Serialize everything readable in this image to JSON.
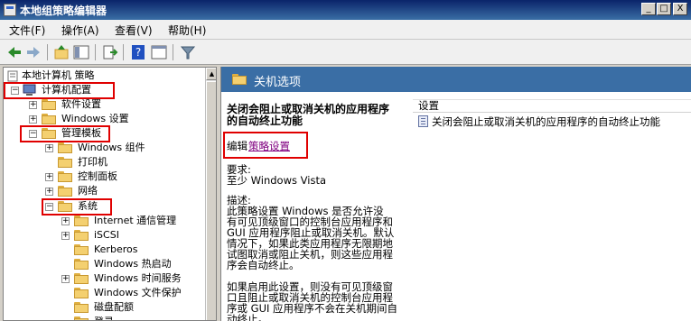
{
  "window": {
    "title": "本地组策略编辑器",
    "controls": {
      "minimize": "_",
      "maximize": "□",
      "close": "X"
    }
  },
  "menu": [
    {
      "label": "文件(F)"
    },
    {
      "label": "操作(A)"
    },
    {
      "label": "查看(V)"
    },
    {
      "label": "帮助(H)"
    }
  ],
  "toolbar": {
    "buttons": [
      "back-icon",
      "forward-icon",
      "up-folder-icon",
      "show-hide-tree-icon",
      "export-list-icon",
      "help-icon",
      "properties-icon",
      "filter-icon"
    ]
  },
  "tree": {
    "root": "本地计算机 策略",
    "computer_config": "计算机配置",
    "software_settings": "软件设置",
    "windows_settings": "Windows 设置",
    "admin_templates": "管理模板",
    "windows_components": "Windows 组件",
    "printers": "打印机",
    "control_panel": "控制面板",
    "network": "网络",
    "system": "系统",
    "internet_comm": "Internet 通信管理",
    "iscsi": "iSCSI",
    "kerberos": "Kerberos",
    "time_sync": "Windows 热启动",
    "time_service": "Windows 时间服务",
    "file_protection": "Windows 文件保护",
    "disk_quota": "磁盘配额",
    "logon": "登录"
  },
  "right": {
    "header": "关机选项",
    "desc_title_1": "关闭会阻止或取消关机的应用程序",
    "desc_title_2": "的自动终止功能",
    "edit_prefix": "编辑",
    "edit_link": "策略设置",
    "req_label": "要求:",
    "req_value": "至少 Windows Vista",
    "desc_label": "描述:",
    "desc_lines": [
      "此策略设置 Windows 是否允许没",
      "有可见顶级窗口的控制台应用程序和",
      "GUI 应用程序阻止或取消关机。默认",
      "情况下，如果此类应用程序无限期地",
      "试图取消或阻止关机，则这些应用程",
      "序会自动终止。",
      "",
      "如果启用此设置，则没有可见顶级窗",
      "口且阻止或取消关机的控制台应用程",
      "序或 GUI 应用程序不会在关机期间自",
      "动终止。"
    ],
    "settings_header": "设置",
    "settings_item": "关闭会阻止或取消关机的应用程序的自动终止功能"
  },
  "colors": {
    "titlebar": "#0a246a",
    "right_header": "#3a6ea5",
    "highlight_box": "#e00000",
    "link": "#800080"
  }
}
